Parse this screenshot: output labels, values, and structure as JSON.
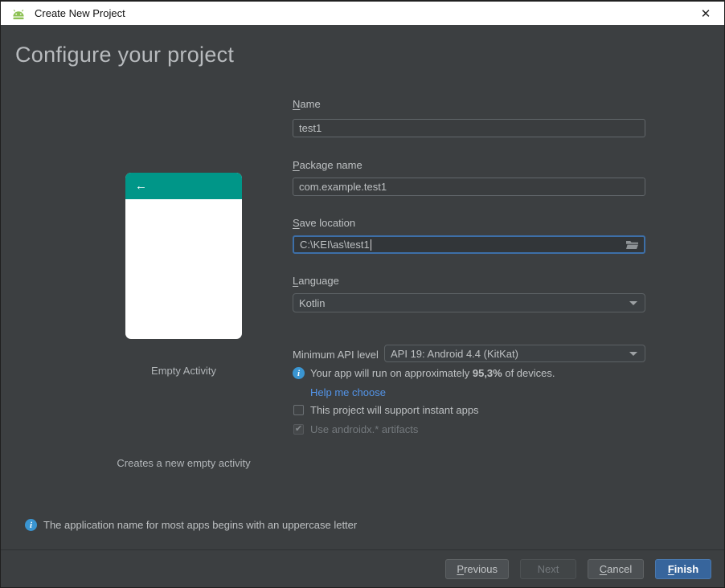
{
  "window": {
    "title": "Create New Project"
  },
  "icons": {
    "close": "✕",
    "back_arrow": "←",
    "checkmark": "✔",
    "info": "i"
  },
  "header": {
    "title": "Configure your project"
  },
  "template": {
    "name": "Empty Activity",
    "description": "Creates a new empty activity"
  },
  "form": {
    "name": {
      "label": "Name",
      "value": "test1"
    },
    "package": {
      "label": "Package name",
      "value": "com.example.test1"
    },
    "save_location": {
      "label": "Save location",
      "value": "C:\\KEI\\as\\test1"
    },
    "language": {
      "label": "Language",
      "value": "Kotlin"
    },
    "min_api": {
      "label": "Minimum API level",
      "value": "API 19: Android 4.4 (KitKat)"
    },
    "api_notice": {
      "prefix": "Your app will run on approximately ",
      "highlight": "95,3%",
      "suffix": " of devices."
    },
    "help_link": "Help me choose",
    "instant_apps": {
      "label": "This project will support instant apps",
      "checked": false
    },
    "androidx": {
      "label": "Use androidx.* artifacts",
      "checked": true
    }
  },
  "footer": {
    "info": "The application name for most apps begins with an uppercase letter"
  },
  "buttons": {
    "previous": "Previous",
    "next": "Next",
    "cancel": "Cancel",
    "finish": "Finish"
  },
  "colors": {
    "accent_teal": "#009688",
    "finish_blue": "#37659c",
    "link_blue": "#5394e8",
    "info_blue": "#3a95d1",
    "android_green": "#8cc152"
  }
}
